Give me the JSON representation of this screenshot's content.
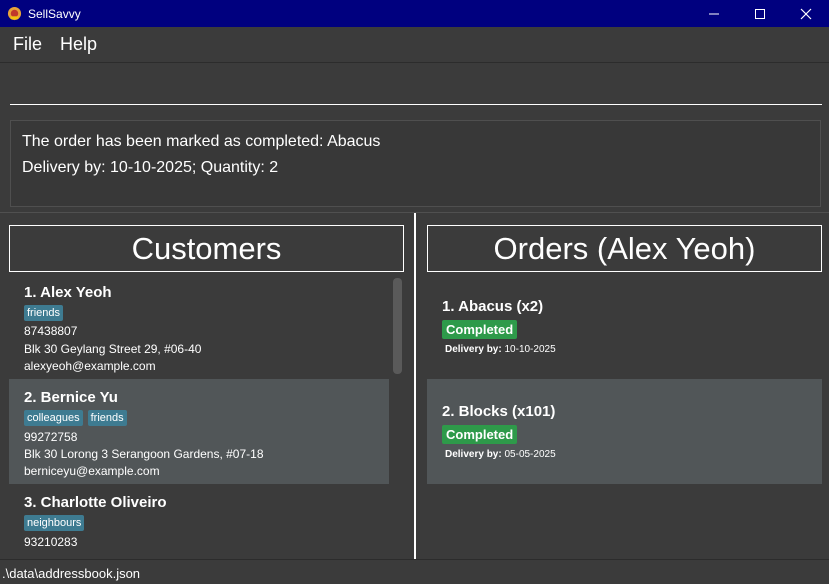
{
  "window": {
    "title": "SellSavvy"
  },
  "menu": {
    "file": "File",
    "help": "Help"
  },
  "command": {
    "value": ""
  },
  "result": {
    "line1": "The order has been marked as completed: Abacus",
    "line2": "Delivery by: 10-10-2025; Quantity: 2"
  },
  "customers": {
    "header": "Customers",
    "items": [
      {
        "name": "1.  Alex Yeoh",
        "tags": [
          "friends"
        ],
        "phone": "87438807",
        "address": "Blk 30 Geylang Street 29, #06-40",
        "email": "alexyeoh@example.com"
      },
      {
        "name": "2.  Bernice Yu",
        "tags": [
          "colleagues",
          "friends"
        ],
        "phone": "99272758",
        "address": "Blk 30 Lorong 3 Serangoon Gardens, #07-18",
        "email": "berniceyu@example.com"
      },
      {
        "name": "3.  Charlotte Oliveiro",
        "tags": [
          "neighbours"
        ],
        "phone": "93210283",
        "address": "",
        "email": ""
      }
    ]
  },
  "orders": {
    "header": "Orders (Alex Yeoh)",
    "delivery_label": "Delivery by:",
    "items": [
      {
        "name": "1.  Abacus (x2)",
        "status": "Completed",
        "delivery": "10-10-2025"
      },
      {
        "name": "2.  Blocks (x101)",
        "status": "Completed",
        "delivery": "05-05-2025"
      }
    ]
  },
  "status_bar": {
    "path": ".\\data\\addressbook.json"
  },
  "colors": {
    "titlebar": "#00007f",
    "tag": "#3e7b91",
    "completed": "#2e9a4a",
    "selected_card": "#515658"
  }
}
